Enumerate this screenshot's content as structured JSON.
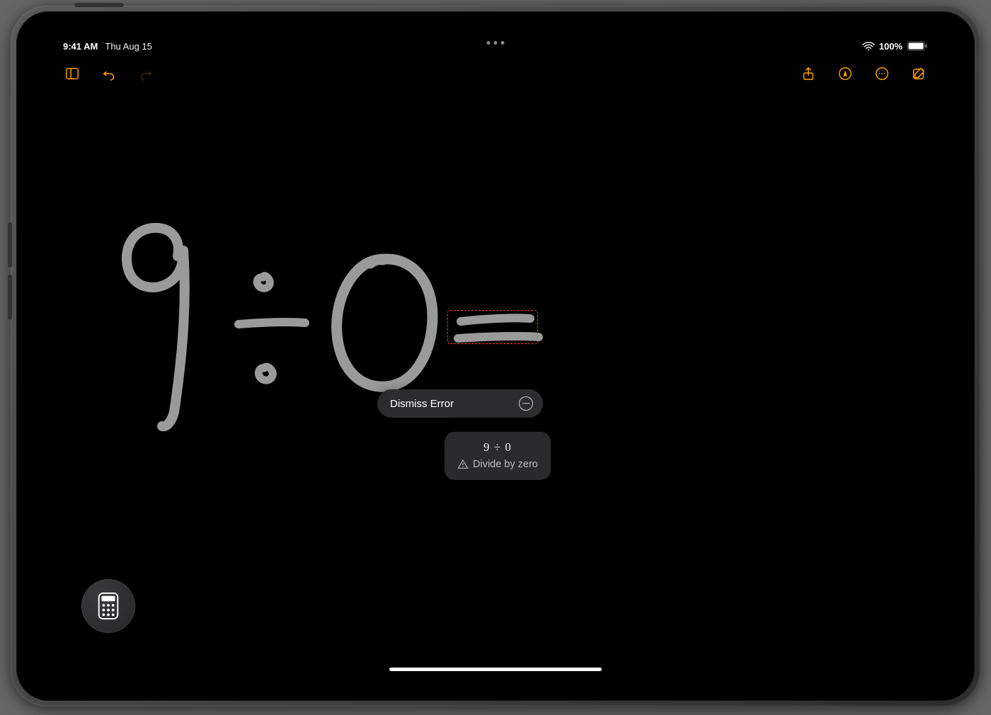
{
  "status": {
    "time": "9:41 AM",
    "date": "Thu Aug 15",
    "battery_percent": "100%"
  },
  "toolbar": {
    "icons": {
      "sidebar": "sidebar-icon",
      "undo": "undo-icon",
      "redo": "redo-icon",
      "share": "share-icon",
      "markup": "markup-icon",
      "more": "more-icon",
      "compose": "compose-icon"
    }
  },
  "handwriting": {
    "expression_text": "9 ÷ 0 ="
  },
  "popover": {
    "dismiss_label": "Dismiss Error"
  },
  "error_card": {
    "expression": "9 ÷ 0",
    "message": "Divide by zero"
  },
  "fab": {
    "name": "calculator-icon"
  },
  "colors": {
    "accent": "#ff9f0a",
    "error": "#ff3b30",
    "ink": "#9a9a9a",
    "panel": "#2c2c2e"
  }
}
